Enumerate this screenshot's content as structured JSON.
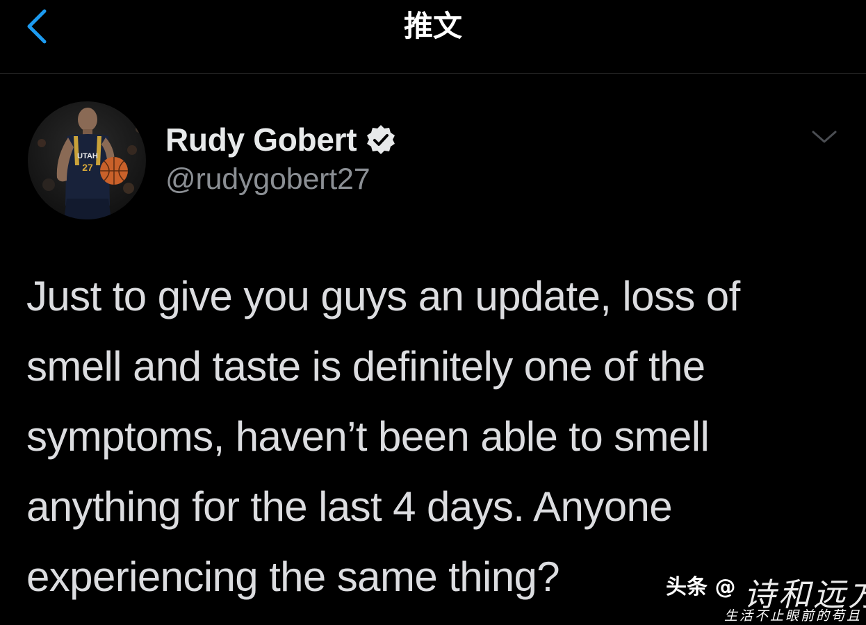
{
  "header": {
    "title": "推文",
    "back_icon": "chevron-left-icon",
    "accent_color": "#1d9bf0"
  },
  "tweet": {
    "author": {
      "name": "Rudy Gobert",
      "handle": "@rudygobert27",
      "verified": true,
      "verified_icon": "verified-badge-icon",
      "avatar_icon": "basketball-player-avatar"
    },
    "more_icon": "chevron-down-icon",
    "text": "Just to give you guys an update, loss of\nsmell and taste is definitely one of the\nsymptoms, haven’t been able to smell\nanything for the last 4 days. Anyone\nexperiencing the same thing?"
  },
  "watermark": {
    "source": "头条 @",
    "signature": "诗和远方",
    "tagline": "生活不止眼前的苟且"
  },
  "colors": {
    "background": "#000000",
    "text": "#dcdde0",
    "secondary_text": "#8b8f94",
    "divider": "#2a2a2a"
  }
}
